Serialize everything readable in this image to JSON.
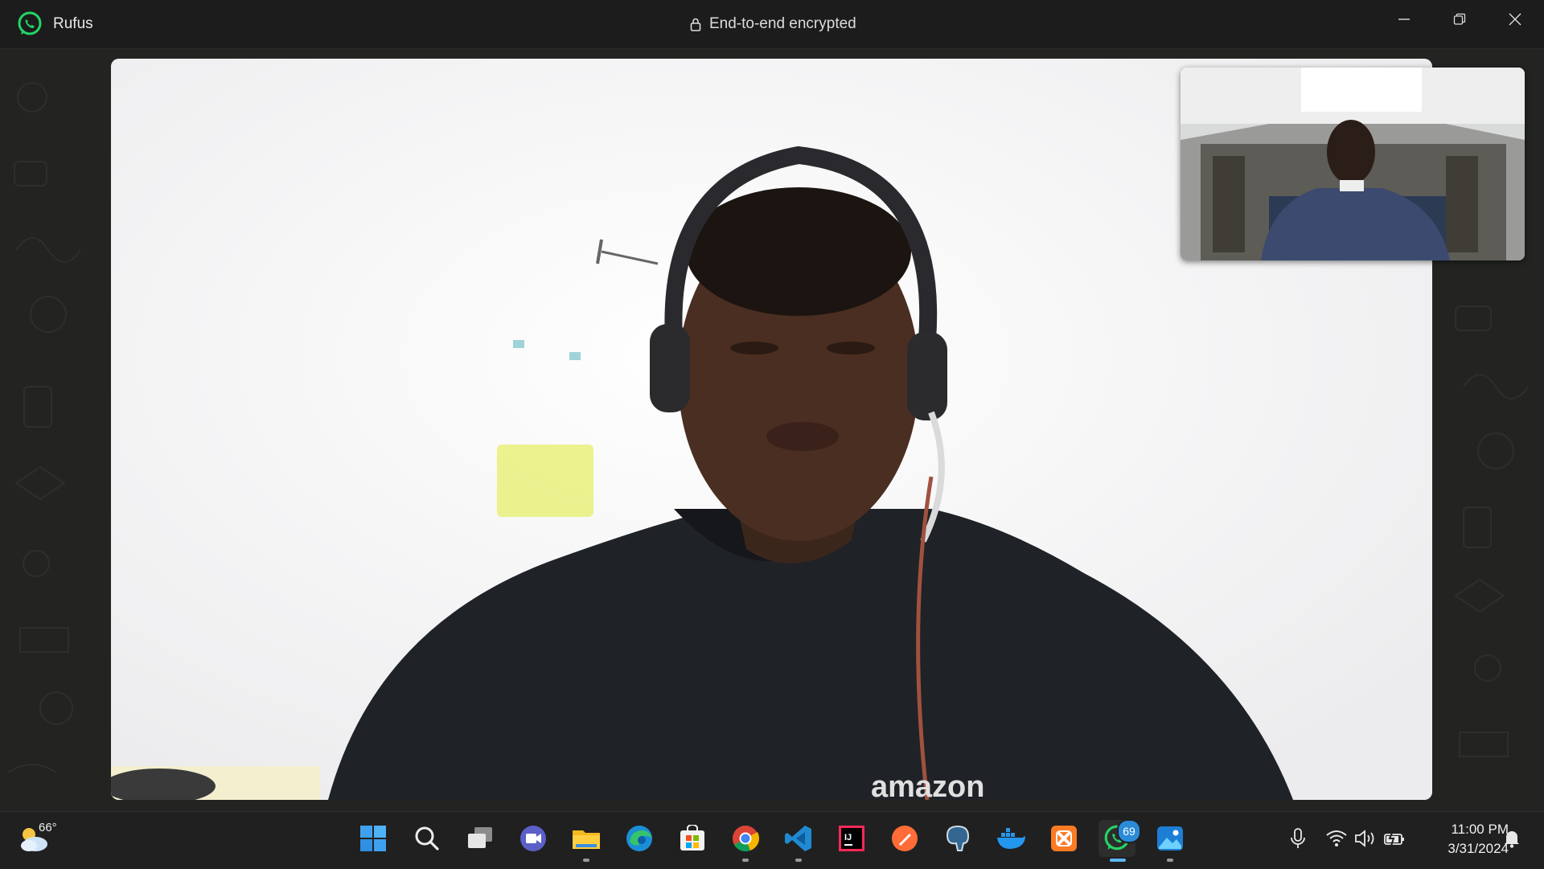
{
  "window": {
    "contact_name": "Rufus",
    "encryption_label": "End-to-end encrypted"
  },
  "icons": {
    "app": "whatsapp-icon",
    "lock": "lock-icon",
    "minimize": "minimize-icon",
    "restore": "restore-icon",
    "close": "close-icon"
  },
  "remote_video": {
    "shirt_text": "amazon"
  },
  "taskbar": {
    "weather_temp": "66°",
    "whatsapp_badge": "69",
    "clock_time": "11:00 PM",
    "clock_date": "3/31/2024",
    "apps": [
      "windows-start-icon",
      "search-icon",
      "task-view-icon",
      "teams-meet-icon",
      "file-explorer-icon",
      "edge-icon",
      "store-icon",
      "chrome-icon",
      "vscode-icon",
      "intellij-icon",
      "postman-icon",
      "postgresql-icon",
      "docker-icon",
      "xampp-icon",
      "whatsapp-icon",
      "photos-icon"
    ],
    "tray": [
      "microphone-icon",
      "wifi-icon",
      "volume-icon",
      "battery-icon",
      "notification-bell-icon"
    ]
  },
  "colors": {
    "whatsapp_green": "#25d366",
    "taskbar_bg": "#202020",
    "badge_blue": "#2a8bd8"
  }
}
